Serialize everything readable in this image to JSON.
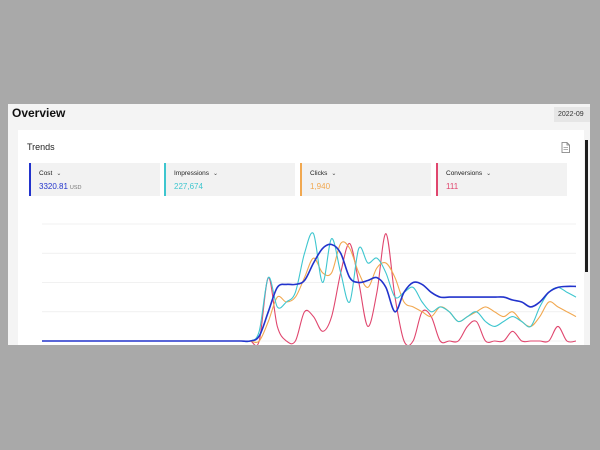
{
  "header": {
    "title": "Overview",
    "date_range": "2022-09"
  },
  "trends": {
    "title": "Trends",
    "export_icon": "export-document-icon",
    "metrics": [
      {
        "label": "Cost",
        "value": "3320.81",
        "unit": "USD",
        "color": "#2233cc"
      },
      {
        "label": "Impressions",
        "value": "227,674",
        "unit": "",
        "color": "#3ec6cf"
      },
      {
        "label": "Clicks",
        "value": "1,940",
        "unit": "",
        "color": "#f1a850"
      },
      {
        "label": "Conversions",
        "value": "111",
        "unit": "",
        "color": "#e0466e"
      }
    ]
  },
  "chart_data": {
    "type": "line",
    "title": "",
    "xlabel": "",
    "ylabel": "",
    "grid": true,
    "x": [
      0,
      1,
      2,
      3,
      4,
      5,
      6,
      7,
      8,
      9,
      10,
      11,
      12,
      13,
      14,
      15,
      16,
      17,
      18,
      19,
      20,
      21,
      22,
      23,
      24,
      25,
      26,
      27,
      28,
      29,
      30,
      31,
      32,
      33,
      34,
      35,
      36,
      37,
      38,
      39,
      40,
      41,
      42,
      43,
      44,
      45,
      46,
      47,
      48,
      49,
      50,
      51,
      52,
      53,
      54,
      55,
      56,
      57,
      58,
      59
    ],
    "series": [
      {
        "name": "Cost",
        "color": "#2233cc",
        "width": 1.6,
        "values": [
          0,
          0,
          0,
          0,
          0,
          0,
          0,
          0,
          0,
          0,
          0,
          0,
          0,
          0,
          0,
          0,
          0,
          0,
          0,
          0,
          0,
          0,
          0,
          0,
          0.05,
          0.3,
          0.55,
          0.58,
          0.58,
          0.62,
          0.8,
          0.95,
          0.99,
          0.9,
          0.65,
          0.6,
          0.62,
          0.65,
          0.55,
          0.3,
          0.5,
          0.6,
          0.58,
          0.5,
          0.45,
          0.45,
          0.45,
          0.45,
          0.45,
          0.45,
          0.45,
          0.45,
          0.42,
          0.4,
          0.35,
          0.4,
          0.5,
          0.55,
          0.56,
          0.56
        ]
      },
      {
        "name": "Impressions",
        "color": "#3ec6cf",
        "width": 1.1,
        "values": [
          0,
          0,
          0,
          0,
          0,
          0,
          0,
          0,
          0,
          0,
          0,
          0,
          0,
          0,
          0,
          0,
          0,
          0,
          0,
          0,
          0,
          0,
          0,
          0,
          0.1,
          0.65,
          0.35,
          0.4,
          0.5,
          0.9,
          1.1,
          0.6,
          1.05,
          0.7,
          0.4,
          0.95,
          0.8,
          0.85,
          0.7,
          0.45,
          0.5,
          0.55,
          0.4,
          0.3,
          0.35,
          0.3,
          0.2,
          0.25,
          0.3,
          0.2,
          0.15,
          0.2,
          0.25,
          0.2,
          0.15,
          0.35,
          0.5,
          0.55,
          0.5,
          0.45
        ]
      },
      {
        "name": "Clicks",
        "color": "#f1a850",
        "width": 1.1,
        "values": [
          0,
          0,
          0,
          0,
          0,
          0,
          0,
          0,
          0,
          0,
          0,
          0,
          0,
          0,
          0,
          0,
          0,
          0,
          0,
          0,
          0,
          0,
          0,
          0,
          0,
          0.2,
          0.45,
          0.4,
          0.45,
          0.65,
          0.85,
          0.7,
          0.7,
          1.0,
          0.95,
          0.7,
          0.55,
          0.75,
          0.8,
          0.65,
          0.4,
          0.35,
          0.3,
          0.25,
          0.35,
          0.3,
          0.2,
          0.25,
          0.3,
          0.35,
          0.3,
          0.25,
          0.3,
          0.2,
          0.15,
          0.25,
          0.4,
          0.35,
          0.3,
          0.25
        ]
      },
      {
        "name": "Conversions",
        "color": "#e0466e",
        "width": 1.1,
        "values": [
          0,
          0,
          0,
          0,
          0,
          0,
          0,
          0,
          0,
          0,
          0,
          0,
          0,
          0,
          0,
          0,
          0,
          0,
          0,
          0,
          0,
          0,
          0,
          0,
          0,
          0.65,
          0.15,
          0,
          0,
          0.3,
          0.25,
          0.1,
          0.25,
          0.7,
          1.0,
          0.6,
          0.15,
          0.5,
          1.1,
          0.45,
          0,
          0,
          0.3,
          0.25,
          0,
          0,
          0,
          0.15,
          0.2,
          0,
          0,
          0,
          0.1,
          0,
          0,
          0,
          0,
          0.15,
          0,
          0
        ]
      }
    ],
    "ylim": [
      0,
      1.2
    ]
  }
}
